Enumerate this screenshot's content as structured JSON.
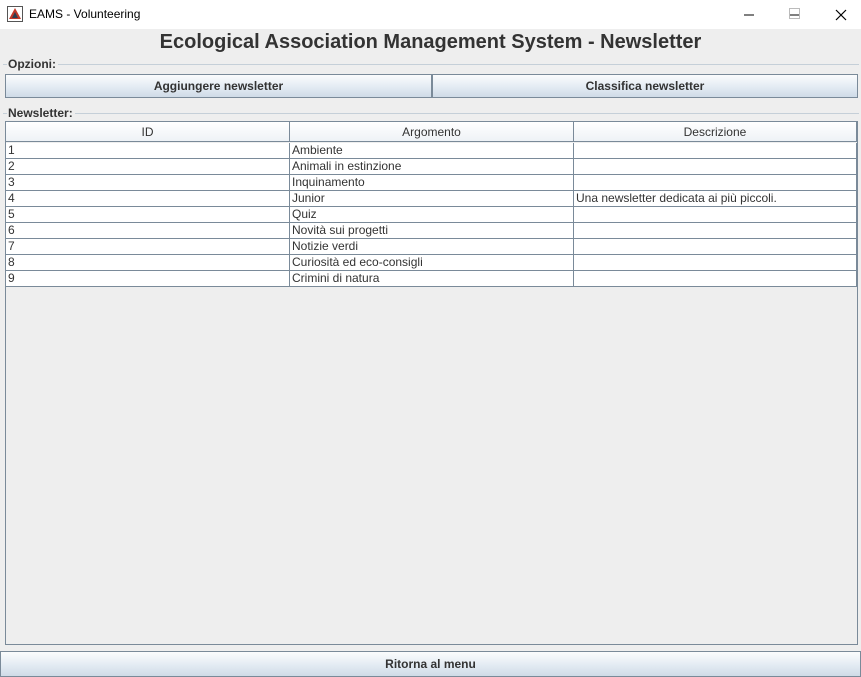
{
  "window": {
    "title": "EAMS - Volunteering",
    "controls": [
      "minimize-icon",
      "maximize-icon",
      "close-icon"
    ]
  },
  "header": {
    "title": "Ecological Association Management System - Newsletter"
  },
  "options": {
    "legend": "Opzioni:",
    "add_label": "Aggiungere newsletter",
    "rank_label": "Classifica newsletter"
  },
  "newsletter": {
    "legend": "Newsletter:",
    "columns": [
      "ID",
      "Argomento",
      "Descrizione"
    ],
    "rows": [
      {
        "id": "1",
        "topic": "Ambiente",
        "desc": ""
      },
      {
        "id": "2",
        "topic": "Animali in estinzione",
        "desc": ""
      },
      {
        "id": "3",
        "topic": "Inquinamento",
        "desc": ""
      },
      {
        "id": "4",
        "topic": "Junior",
        "desc": "Una newsletter dedicata ai più piccoli."
      },
      {
        "id": "5",
        "topic": "Quiz",
        "desc": ""
      },
      {
        "id": "6",
        "topic": "Novità sui progetti",
        "desc": ""
      },
      {
        "id": "7",
        "topic": "Notizie verdi",
        "desc": ""
      },
      {
        "id": "8",
        "topic": "Curiosità ed eco-consigli",
        "desc": ""
      },
      {
        "id": "9",
        "topic": "Crimini di natura",
        "desc": ""
      }
    ]
  },
  "footer": {
    "back_label": "Ritorna al menu"
  },
  "colors": {
    "button_border": "#7a8a99",
    "button_gradient_top": "#fbfcfd",
    "button_gradient_bottom": "#cfdbe7",
    "background": "#eeeeee"
  }
}
